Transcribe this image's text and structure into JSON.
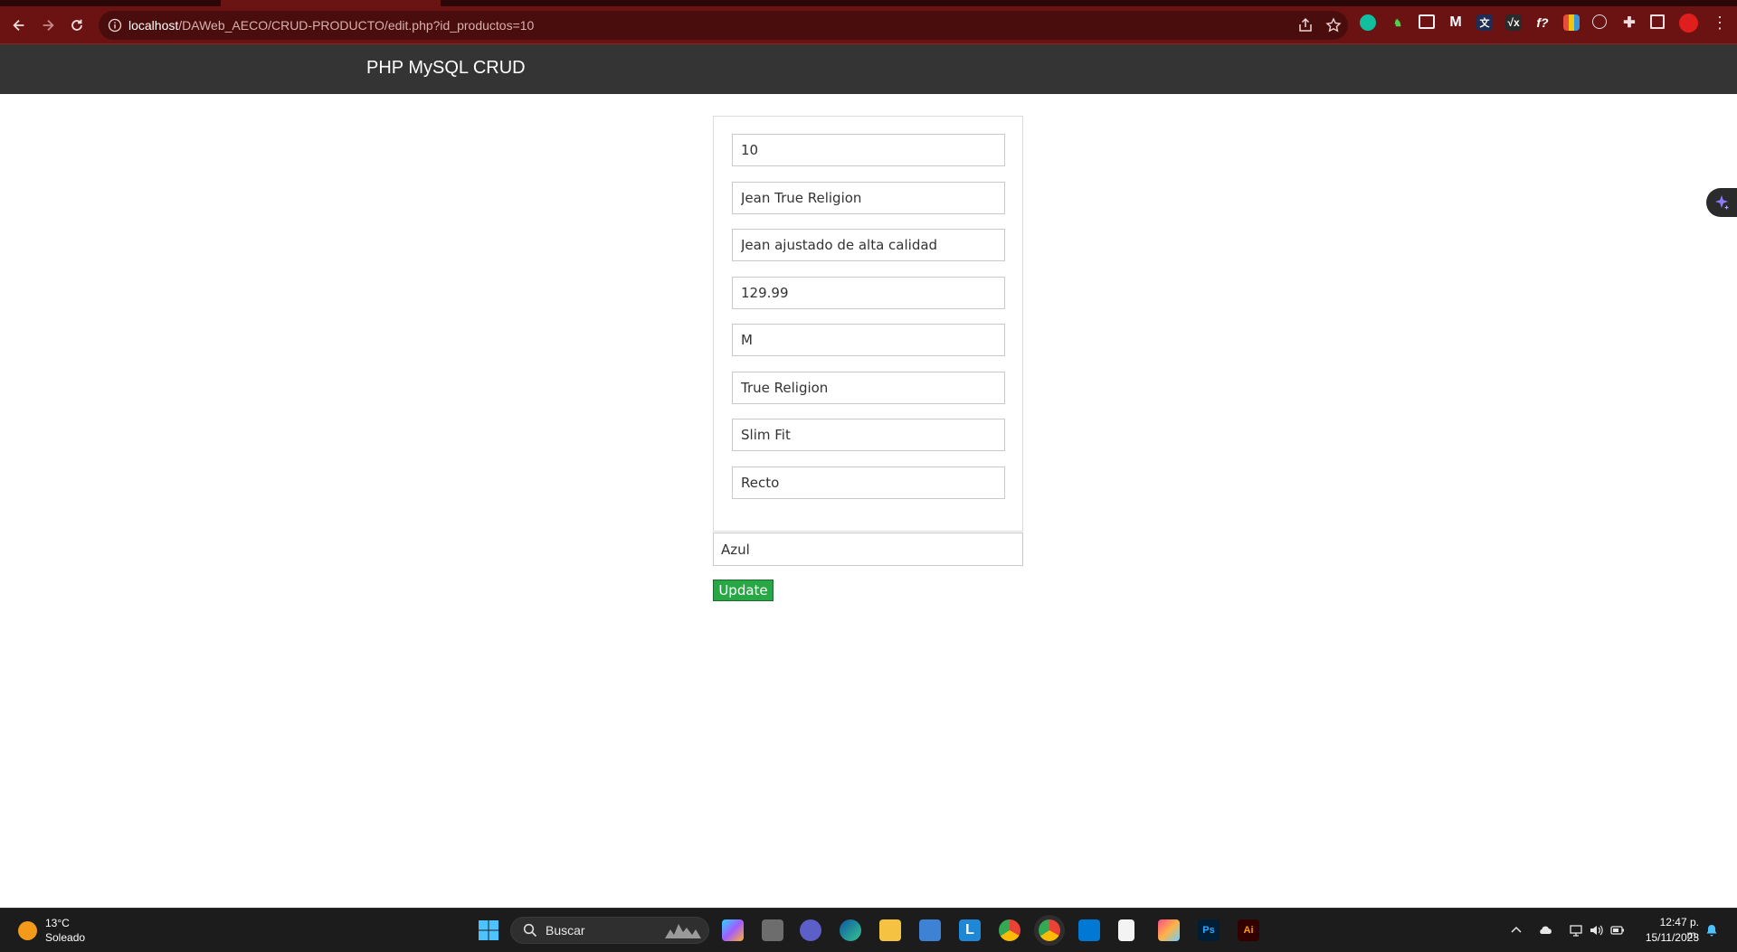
{
  "browser": {
    "url_host": "localhost",
    "url_path": "/DAWeb_AECO/CRUD-PRODUCTO/edit.php?id_productos=10",
    "theme_color": "#6b1212"
  },
  "navbar": {
    "brand": "PHP MySQL CRUD"
  },
  "form": {
    "fields": [
      {
        "value": "10"
      },
      {
        "value": "Jean True Religion"
      },
      {
        "value": "Jean ajustado de alta calidad"
      },
      {
        "value": "129.99"
      },
      {
        "value": "M"
      },
      {
        "value": "True Religion"
      },
      {
        "value": "Slim Fit"
      },
      {
        "value": "Recto"
      },
      {
        "value": "Azul"
      }
    ],
    "submit_label": "Update",
    "submit_color": "#28a745"
  },
  "taskbar": {
    "weather": {
      "temp": "13°C",
      "desc": "Soleado"
    },
    "search_placeholder": "Buscar",
    "clock": {
      "time": "12:47 p. m.",
      "date": "15/11/2023"
    }
  }
}
